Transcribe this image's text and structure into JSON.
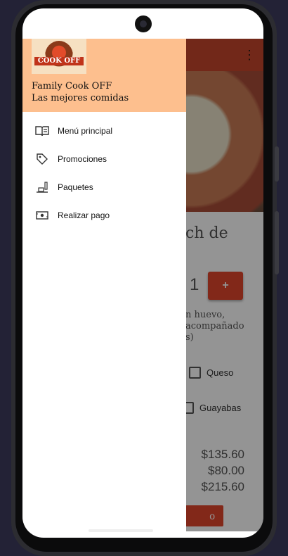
{
  "drawer": {
    "logo_text": "COOK OFF",
    "title": "Family Cook OFF",
    "subtitle": "Las mejores comidas",
    "items": [
      {
        "label": "Menú principal",
        "icon": "book-icon"
      },
      {
        "label": "Promociones",
        "icon": "tag-icon"
      },
      {
        "label": "Paquetes",
        "icon": "package-icon"
      },
      {
        "label": "Realizar pago",
        "icon": "payment-icon"
      }
    ]
  },
  "appbar": {
    "overflow_icon": "⋮"
  },
  "product": {
    "title_fragment": "ch de",
    "quantity": "1",
    "plus_label": "+",
    "description_lines": [
      "n huevo,",
      "acompañado",
      "s)"
    ]
  },
  "options": [
    {
      "label": "Queso"
    },
    {
      "label": "Guayabas"
    }
  ],
  "prices": [
    "$135.60",
    "$80.00",
    "$215.60"
  ],
  "order_button_label": "o",
  "colors": {
    "appbar": "#c4452b",
    "accent": "#e0452b",
    "drawer_header": "#fdbf8e"
  }
}
